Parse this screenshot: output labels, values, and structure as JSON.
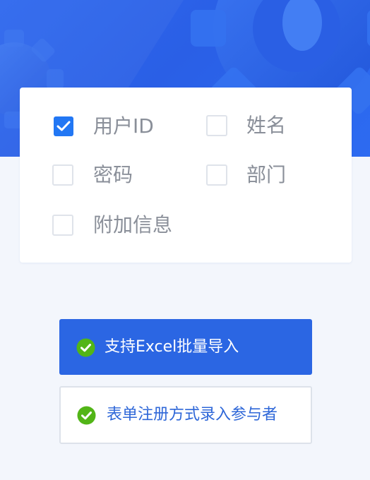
{
  "colors": {
    "hero_blue": "#2f69ee",
    "page_background": "#f3f6fc",
    "checkbox_checked": "#2277f4",
    "primary_button": "#2b66e3",
    "success_green": "#52b517",
    "secondary_text_blue": "#2e67d8",
    "option_text_gray": "#8a8f99"
  },
  "hero": {
    "decoration_icon": "gear-icon"
  },
  "options": [
    {
      "label": "用户ID",
      "checked": true
    },
    {
      "label": "姓名",
      "checked": false
    },
    {
      "label": "密码",
      "checked": false
    },
    {
      "label": "部门",
      "checked": false
    },
    {
      "label": "附加信息",
      "checked": false
    }
  ],
  "buttons": {
    "primary": {
      "label": "支持Excel批量导入",
      "icon": "check-circle-icon"
    },
    "secondary": {
      "label": "表单注册方式录入参与者",
      "icon": "check-circle-icon"
    }
  }
}
